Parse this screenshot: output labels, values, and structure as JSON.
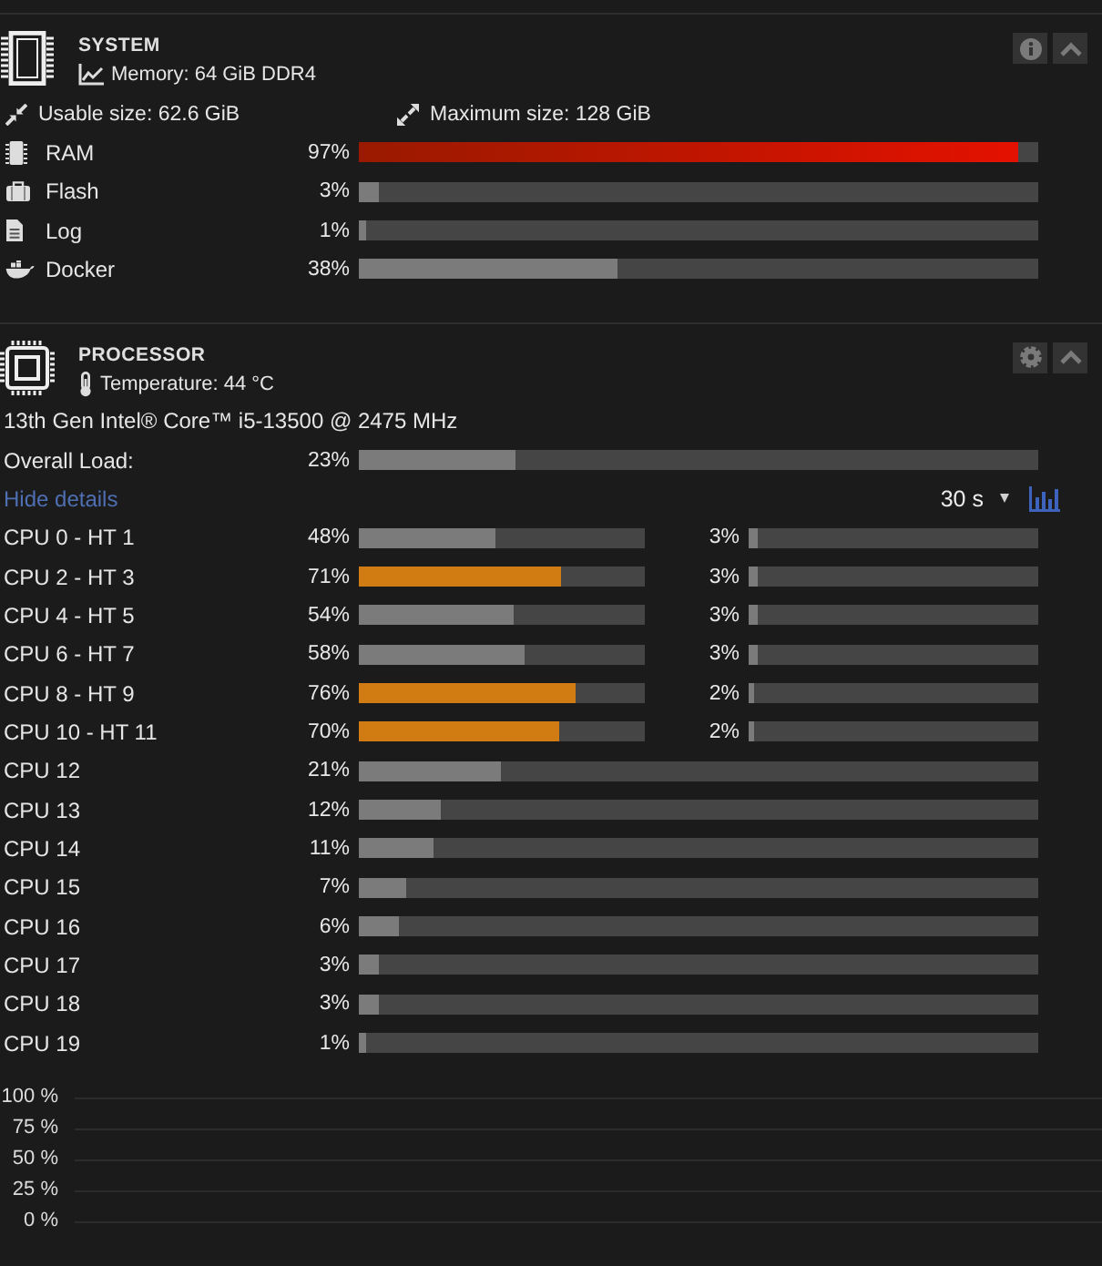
{
  "system": {
    "title": "SYSTEM",
    "subtitle": "Memory: 64 GiB DDR4",
    "usable_size": "Usable size: 62.6 GiB",
    "maximum_size": "Maximum size: 128 GiB",
    "usage": [
      {
        "kind": "ram",
        "label": "RAM",
        "reading": "97%",
        "level": 0.97
      },
      {
        "kind": "flash",
        "label": "Flash",
        "reading": "3%",
        "level": 0.03
      },
      {
        "kind": "log",
        "label": "Log",
        "reading": "1%",
        "level": 0.01
      },
      {
        "kind": "docker",
        "label": "Docker",
        "reading": "38%",
        "level": 0.38
      }
    ]
  },
  "processor": {
    "title": "PROCESSOR",
    "subtitle": "Temperature: 44 °C",
    "model": "13th Gen Intel® Core™ i5-13500 @ 2475 MHz",
    "overall": {
      "label": "Overall Load:",
      "reading": "23%",
      "level": 0.23
    },
    "details_link": "Hide details",
    "interval": "30 s",
    "cores": [
      {
        "kind": "pair",
        "label": "CPU 0 - HT 1",
        "reading": "48%",
        "level": 0.48,
        "ht": {
          "reading": "3%",
          "level": 0.03
        }
      },
      {
        "kind": "pair",
        "label": "CPU 2 - HT 3",
        "reading": "71%",
        "level": 0.71,
        "ht": {
          "reading": "3%",
          "level": 0.03
        }
      },
      {
        "kind": "pair",
        "label": "CPU 4 - HT 5",
        "reading": "54%",
        "level": 0.54,
        "ht": {
          "reading": "3%",
          "level": 0.03
        }
      },
      {
        "kind": "pair",
        "label": "CPU 6 - HT 7",
        "reading": "58%",
        "level": 0.58,
        "ht": {
          "reading": "3%",
          "level": 0.03
        }
      },
      {
        "kind": "pair",
        "label": "CPU 8 - HT 9",
        "reading": "76%",
        "level": 0.76,
        "ht": {
          "reading": "2%",
          "level": 0.02
        }
      },
      {
        "kind": "pair",
        "label": "CPU 10 - HT 11",
        "reading": "70%",
        "level": 0.7,
        "ht": {
          "reading": "2%",
          "level": 0.02
        }
      },
      {
        "kind": "single",
        "label": "CPU 12",
        "reading": "21%",
        "level": 0.21
      },
      {
        "kind": "single",
        "label": "CPU 13",
        "reading": "12%",
        "level": 0.12
      },
      {
        "kind": "single",
        "label": "CPU 14",
        "reading": "11%",
        "level": 0.11
      },
      {
        "kind": "single",
        "label": "CPU 15",
        "reading": "7%",
        "level": 0.07
      },
      {
        "kind": "single",
        "label": "CPU 16",
        "reading": "6%",
        "level": 0.06
      },
      {
        "kind": "single",
        "label": "CPU 17",
        "reading": "3%",
        "level": 0.03
      },
      {
        "kind": "single",
        "label": "CPU 18",
        "reading": "3%",
        "level": 0.03
      },
      {
        "kind": "single",
        "label": "CPU 19",
        "reading": "1%",
        "level": 0.01
      }
    ],
    "chart_data": {
      "type": "line",
      "categories": [
        null,
        null
      ],
      "ylim": [
        0,
        100
      ],
      "yticks": [
        {
          "value": 100,
          "label": "100 %"
        },
        {
          "value": 75,
          "label": "75 %"
        },
        {
          "value": 50,
          "label": "50 %"
        },
        {
          "value": 25,
          "label": "25 %"
        },
        {
          "value": 0,
          "label": "0 %"
        }
      ],
      "grid": true
    }
  }
}
